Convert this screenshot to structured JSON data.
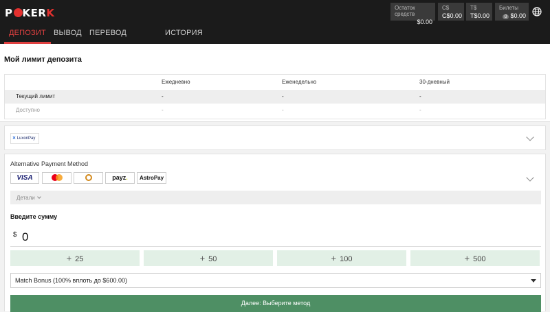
{
  "brand": {
    "logo_pre": "P",
    "logo_mid": "KER",
    "logo_post": "K",
    "accent": "#e3312f"
  },
  "balances": [
    {
      "label": "Остаток средств",
      "value": "$0.00"
    },
    {
      "label": "C$",
      "value": "C$0.00"
    },
    {
      "label": "T$",
      "value": "T$0.00"
    },
    {
      "label": "Билеты",
      "count": "0",
      "value": "$0.00"
    }
  ],
  "nav": {
    "tabs": [
      {
        "label": "ДЕПОЗИТ",
        "active": true
      },
      {
        "label": "ВЫВОД"
      },
      {
        "label": "ПЕРЕВОД СРЕДСТВ"
      },
      {
        "label": "ИСТОРИЯ ТРАНЗАКЦИЙ"
      }
    ],
    "active_color": "#e04040"
  },
  "limit": {
    "title": "Мой лимит депозита",
    "columns": [
      "Ежедневно",
      "Еженедельно",
      "30-дневный"
    ],
    "rows": [
      {
        "label": "Текущий лимит",
        "values": [
          "-",
          "-",
          "-"
        ]
      },
      {
        "label": "Доступно",
        "values": [
          "-",
          "-",
          "-"
        ]
      }
    ]
  },
  "luxon": {
    "logo_text": "LuxonPay"
  },
  "alt": {
    "title": "Alternative Payment Method",
    "methods": {
      "visa": "VISA",
      "payz": "payz",
      "astro": "AstroPay"
    },
    "details_label": "Детали",
    "amount_title": "Введите сумму",
    "currency": "$",
    "amount": "0",
    "quick": [
      "25",
      "50",
      "100",
      "500"
    ],
    "bonus": "Match Bonus (100% вплоть до $600.00)",
    "next_label": "Далее: Выберите метод",
    "next_color": "#4e8f64"
  }
}
